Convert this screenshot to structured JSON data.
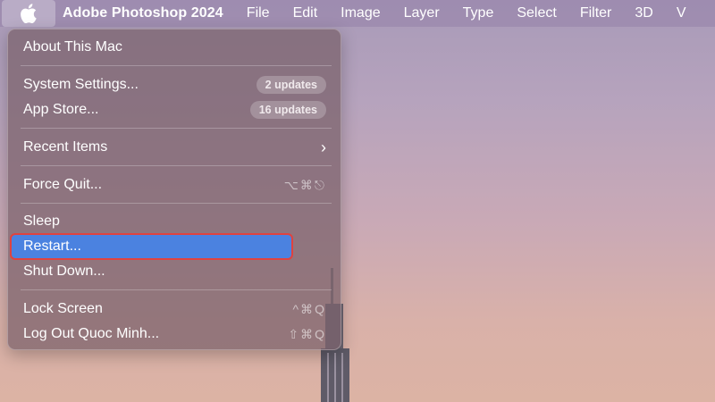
{
  "menubar": {
    "apple_icon": "apple-logo-icon",
    "app_name": "Adobe Photoshop 2024",
    "items": [
      "File",
      "Edit",
      "Image",
      "Layer",
      "Type",
      "Select",
      "Filter",
      "3D",
      "V"
    ]
  },
  "apple_menu": {
    "about": "About This Mac",
    "system_settings": {
      "label": "System Settings...",
      "badge": "2 updates"
    },
    "app_store": {
      "label": "App Store...",
      "badge": "16 updates"
    },
    "recent_items": {
      "label": "Recent Items",
      "chevron": "›"
    },
    "force_quit": {
      "label": "Force Quit...",
      "shortcut": "⌥⌘⎋"
    },
    "sleep": "Sleep",
    "restart": "Restart...",
    "shut_down": "Shut Down...",
    "lock_screen": {
      "label": "Lock Screen",
      "shortcut": "^⌘Q"
    },
    "log_out": {
      "label": "Log Out Quoc Minh...",
      "shortcut": "⇧⌘Q"
    },
    "selected_item": "Restart..."
  },
  "colors": {
    "highlight": "#4b82e0",
    "annotation_box": "#e0433f"
  }
}
